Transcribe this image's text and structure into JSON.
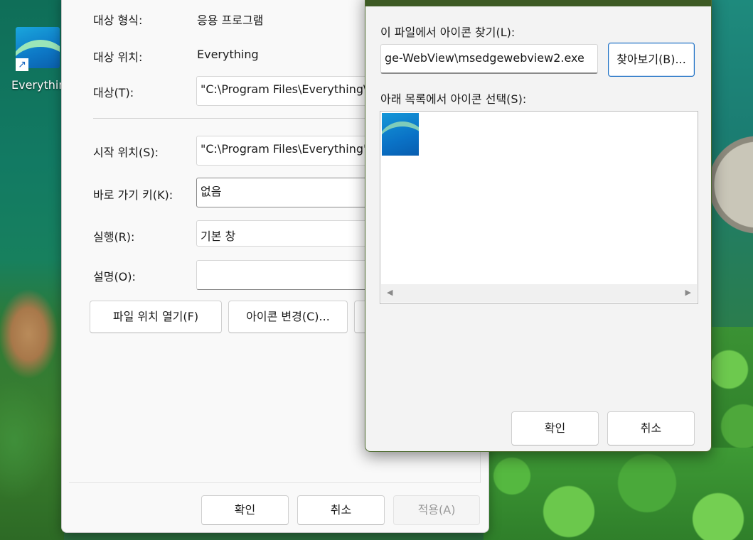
{
  "desktop": {
    "icon_label": "Everythin"
  },
  "properties": {
    "target_type_label": "대상 형식:",
    "target_type_value": "응용 프로그램",
    "target_location_label": "대상 위치:",
    "target_location_value": "Everything",
    "target_label": "대상(T):",
    "target_value": "\"C:\\Program Files\\Everything\\",
    "start_in_label": "시작 위치(S):",
    "start_in_value": "\"C:\\Program Files\\Everything\"",
    "shortcut_key_label": "바로 가기 키(K):",
    "shortcut_key_value": "없음",
    "run_label": "실행(R):",
    "run_value": "기본 창",
    "comment_label": "설명(O):",
    "comment_value": "",
    "open_location_button": "파일 위치 열기(F)",
    "change_icon_button": "아이콘 변경(C)...",
    "ok_button": "확인",
    "cancel_button": "취소",
    "apply_button": "적용(A)"
  },
  "change_icon_dialog": {
    "find_label": "이 파일에서 아이콘 찾기(L):",
    "path_value": "ge-WebView\\msedgewebview2.exe",
    "browse_button": "찾아보기(B)...",
    "select_label": "아래 목록에서 아이콘 선택(S):",
    "ok_button": "확인",
    "cancel_button": "취소",
    "scroll_left": "◀",
    "scroll_right": "▶"
  }
}
